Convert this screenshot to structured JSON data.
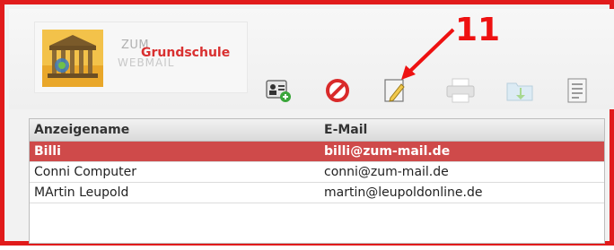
{
  "annotation": {
    "number": "11",
    "color": "#ee1111"
  },
  "logo": {
    "line1": "ZUM",
    "line2": "WEBMAIL",
    "school": "Grundschule"
  },
  "toolbar": {
    "icons": [
      "add-contact-icon",
      "delete-icon",
      "edit-icon",
      "print-icon",
      "move-to-folder-icon",
      "export-vcard-icon"
    ]
  },
  "table": {
    "headers": [
      "Anzeigename",
      "E-Mail"
    ],
    "rows": [
      {
        "name": "Billi",
        "email": "billi@zum-mail.de",
        "selected": true
      },
      {
        "name": "Conni Computer",
        "email": "conni@zum-mail.de",
        "selected": false
      },
      {
        "name": "MArtin Leupold",
        "email": "martin@leupoldonline.de",
        "selected": false
      }
    ]
  },
  "colors": {
    "frame": "#e11b1b",
    "selected_row": "#cf4a4a"
  }
}
